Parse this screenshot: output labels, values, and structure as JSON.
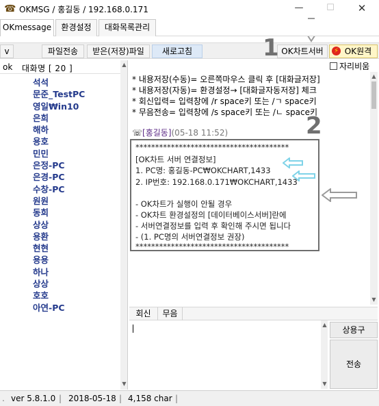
{
  "window": {
    "title": "OKMSG / 홍길동 / 192.168.0.171",
    "min": "—",
    "max": "☐",
    "close": "✕"
  },
  "menu": [
    {
      "label": "OKmessage"
    },
    {
      "label": "환경설정"
    },
    {
      "label": "대화목록관리"
    }
  ],
  "toolbar": {
    "collapse": "v",
    "file_send": "파일전송",
    "received_files": "받은(저장)파일",
    "refresh": "새로고침",
    "ok_server": "OK차트서버",
    "ok_remote": "OK원격",
    "ok_remote_icon": "lightning-icon"
  },
  "left": {
    "col_ok": "ok",
    "col_name": "대화명 [ 20 ]",
    "items": [
      {
        "name": "석석"
      },
      {
        "name": "문준_TestPC"
      },
      {
        "name": "영일₩in10"
      },
      {
        "name": "은희"
      },
      {
        "name": "해하"
      },
      {
        "name": "용호"
      },
      {
        "name": "민민"
      },
      {
        "name": "은정-PC"
      },
      {
        "name": "은경-PC"
      },
      {
        "name": "수창-PC"
      },
      {
        "name": "원원"
      },
      {
        "name": "동희"
      },
      {
        "name": "상상"
      },
      {
        "name": "용환"
      },
      {
        "name": "현현"
      },
      {
        "name": "용용"
      },
      {
        "name": "하나"
      },
      {
        "name": "상상"
      },
      {
        "name": "호호"
      },
      {
        "name": "아연-PC"
      }
    ]
  },
  "chat": {
    "fixed_position_label": "자리비움",
    "hints": [
      "* 내용저장(수동)= 오른쪽마우스 클릭 후 [대화글저장]",
      "* 내용저장(자동)= 환경설정→ [대화글자동저장] 체크",
      "* 회신입력= 입력창에 /r space키 또는 /ㄱ space키",
      "* 무음전송= 입력창에 /s space키 또는 /ㄴ space키"
    ],
    "sender_icon": "☏",
    "sender_name": "[홍길동]",
    "sender_time": "(05-18 11:52)",
    "message": [
      "***************************************",
      "[OK차트 서버 연결정보]",
      "1. PC명: 홍길동-PC₩OKCHART,1433",
      "2. IP번호: 192.168.0.171₩OKCHART,1433",
      "",
      "- OK차트가 실행이 안될 경우",
      "- OK차트 환경설정의 [데이터베이스서버]란에",
      "- 서버연결정보를 입력 후 확인해 주시면 됩니다",
      "- (1. PC명의 서버연결정보 권장)",
      "***************************************"
    ]
  },
  "input_tabs": {
    "reply": "회신",
    "silent": "무음"
  },
  "side_buttons": {
    "phrases": "상용구",
    "send": "전송"
  },
  "status": {
    "version": "ver 5.8.1.0",
    "date": "2018-05-18",
    "chars": "4,158 char"
  },
  "annotations": {
    "one": "1",
    "two": "2"
  },
  "colors": {
    "arrow_cyan": "#7fd3e8",
    "arrow_gray": "#9a9a9a",
    "list_name": "#243a8c",
    "sender_name": "#5b2a86"
  }
}
